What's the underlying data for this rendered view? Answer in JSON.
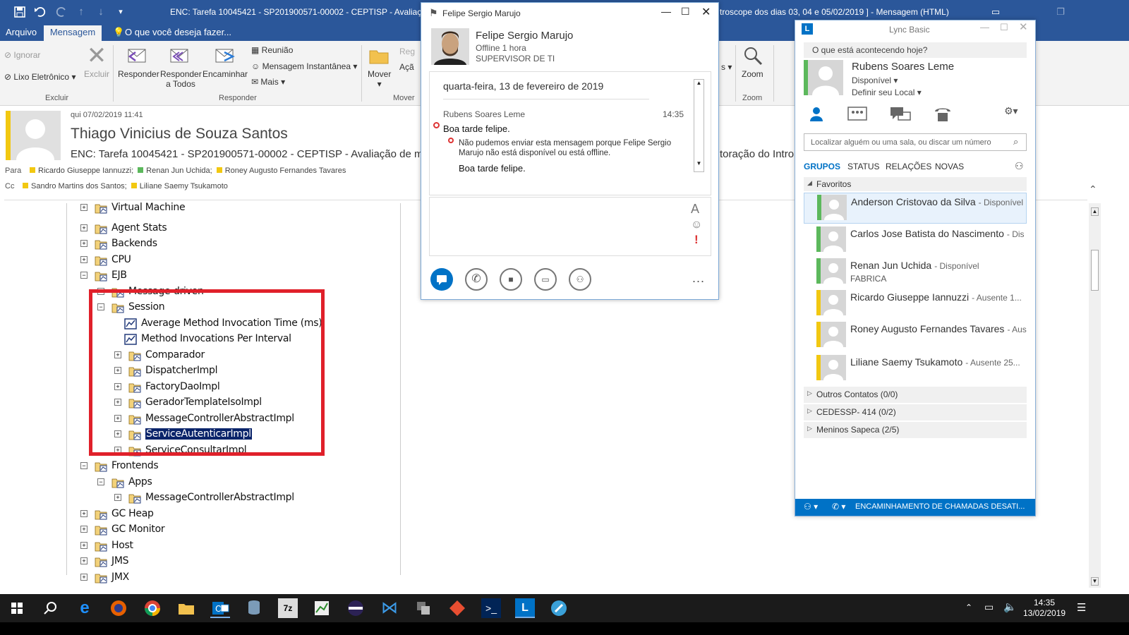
{
  "outlook": {
    "window_title": "ENC: Tarefa 10045421 - SP201900571-00002 - CEPTISP - Avaliação de r",
    "window_title_right": "troscope dos dias 03, 04  e 05/02/2019 ] - Mensagem (HTML)",
    "tabs": {
      "file": "Arquivo",
      "message": "Mensagem",
      "tell_me": "O que você deseja fazer..."
    },
    "ribbon": {
      "ignore": "Ignorar",
      "junk": "Lixo Eletrônico",
      "delete": "Excluir",
      "reply": "Responder",
      "reply_all_1": "Responder",
      "reply_all_2": "a Todos",
      "forward": "Encaminhar",
      "meeting": "Reunião",
      "im": "Mensagem Instantânea",
      "more": "Mais",
      "move": "Mover",
      "zoom": "Zoom",
      "group_delete": "Excluir",
      "group_respond": "Responder",
      "group_move": "Mover",
      "group_zoom": "Zoom",
      "clipped_1": "Reg",
      "clipped_2": "Açã"
    },
    "header": {
      "date": "qui 07/02/2019 11:41",
      "sender": "Thiago Vinicius de Souza Santos",
      "subject": "ENC: Tarefa 10045421 - SP201900571-00002 - CEPTISP - Avaliação de monit",
      "subject_right": "toração do Intro",
      "to_label": "Para",
      "to": [
        "Ricardo Giuseppe Iannuzzi;",
        "Renan Jun Uchida;",
        "Roney Augusto Fernandes Tavares"
      ],
      "to_colors": [
        "#f2c811",
        "#5cb85c",
        "#f2c811"
      ],
      "cc_label": "Cc",
      "cc": [
        "Sandro Martins dos Santos;",
        "Liliane Saemy Tsukamoto"
      ],
      "cc_colors": [
        "#f2c811",
        "#f2c811"
      ]
    },
    "tree": [
      {
        "label": "Virtual Machine",
        "level": 1,
        "pm": "+"
      },
      {
        "label": "Agent Stats",
        "level": 1,
        "pm": "+"
      },
      {
        "label": "Backends",
        "level": 1,
        "pm": "+"
      },
      {
        "label": "CPU",
        "level": 1,
        "pm": "+"
      },
      {
        "label": "EJB",
        "level": 1,
        "pm": "-"
      },
      {
        "label": "Message-driven",
        "level": 2,
        "pm": "+"
      },
      {
        "label": "Session",
        "level": 2,
        "pm": "-"
      },
      {
        "label": "Average Method Invocation Time (ms)",
        "level": 3,
        "pm": "",
        "metric": true
      },
      {
        "label": "Method Invocations Per Interval",
        "level": 3,
        "pm": "",
        "metric": true
      },
      {
        "label": "Comparador",
        "level": 3,
        "pm": "+"
      },
      {
        "label": "DispatcherImpl",
        "level": 3,
        "pm": "+"
      },
      {
        "label": "FactoryDaoImpl",
        "level": 3,
        "pm": "+"
      },
      {
        "label": "GeradorTemplateIsoImpl",
        "level": 3,
        "pm": "+"
      },
      {
        "label": "MessageControllerAbstractImpl",
        "level": 3,
        "pm": "+"
      },
      {
        "label": "ServiceAutenticarImpl",
        "level": 3,
        "pm": "+",
        "selected": true
      },
      {
        "label": "ServiceConsultarImpl",
        "level": 3,
        "pm": "+"
      },
      {
        "label": "Frontends",
        "level": 1,
        "pm": "-"
      },
      {
        "label": "Apps",
        "level": 2,
        "pm": "-"
      },
      {
        "label": "MessageControllerAbstractImpl",
        "level": 3,
        "pm": "+"
      },
      {
        "label": "GC Heap",
        "level": 1,
        "pm": "+"
      },
      {
        "label": "GC Monitor",
        "level": 1,
        "pm": "+"
      },
      {
        "label": "Host",
        "level": 1,
        "pm": "+"
      },
      {
        "label": "JMS",
        "level": 1,
        "pm": "+"
      },
      {
        "label": "JMX",
        "level": 1,
        "pm": "+"
      }
    ]
  },
  "chat": {
    "title": "Felipe Sergio Marujo",
    "name": "Felipe Sergio Marujo",
    "status": "Offline 1 hora",
    "role": "SUPERVISOR DE TI",
    "date": "quarta-feira, 13 de fevereiro de 2019",
    "sender": "Rubens Soares Leme",
    "time": "14:35",
    "message": "Boa tarde felipe.",
    "error": "Não pudemos enviar esta mensagem porque Felipe Sergio Marujo não está disponível ou está offline.",
    "error_quote": "Boa tarde felipe.",
    "more": "..."
  },
  "lync": {
    "title": "Lync Basic",
    "whats_happening": "O que está acontecendo hoje?",
    "user_name": "Rubens Soares Leme",
    "user_status": "Disponível",
    "user_location": "Definir seu Local",
    "search_placeholder": "Localizar alguém ou uma sala, ou discar um número",
    "tabs": [
      "GRUPOS",
      "STATUS",
      "RELAÇÕES",
      "NOVAS"
    ],
    "favorites_label": "Favoritos",
    "contacts": [
      {
        "name": "Anderson Cristovao da Silva",
        "status": "- Disponível",
        "color": "#5cb85c",
        "extra": ""
      },
      {
        "name": "Carlos Jose Batista do Nascimento",
        "status": "- Dis",
        "color": "#5cb85c",
        "extra": ""
      },
      {
        "name": "Renan Jun Uchida",
        "status": "- Disponível",
        "color": "#5cb85c",
        "extra": "FABRICA"
      },
      {
        "name": "Ricardo Giuseppe Iannuzzi",
        "status": "- Ausente 1...",
        "color": "#f2c811",
        "extra": ""
      },
      {
        "name": "Roney Augusto Fernandes Tavares",
        "status": "- Aus",
        "color": "#f2c811",
        "extra": ""
      },
      {
        "name": "Liliane Saemy Tsukamoto",
        "status": "- Ausente 25...",
        "color": "#f2c811",
        "extra": ""
      }
    ],
    "groups": [
      "Outros Contatos (0/0)",
      "CEDESSP- 414 (0/2)",
      "Meninos Sapeca (2/5)"
    ],
    "footer": "ENCAMINHAMENTO DE CHAMADAS DESATI..."
  },
  "taskbar": {
    "time": "14:35",
    "date": "13/02/2019"
  },
  "colors": {
    "outlook_blue": "#2b579a",
    "lync_blue": "#0072c6",
    "highlight_red": "#e0202a"
  }
}
